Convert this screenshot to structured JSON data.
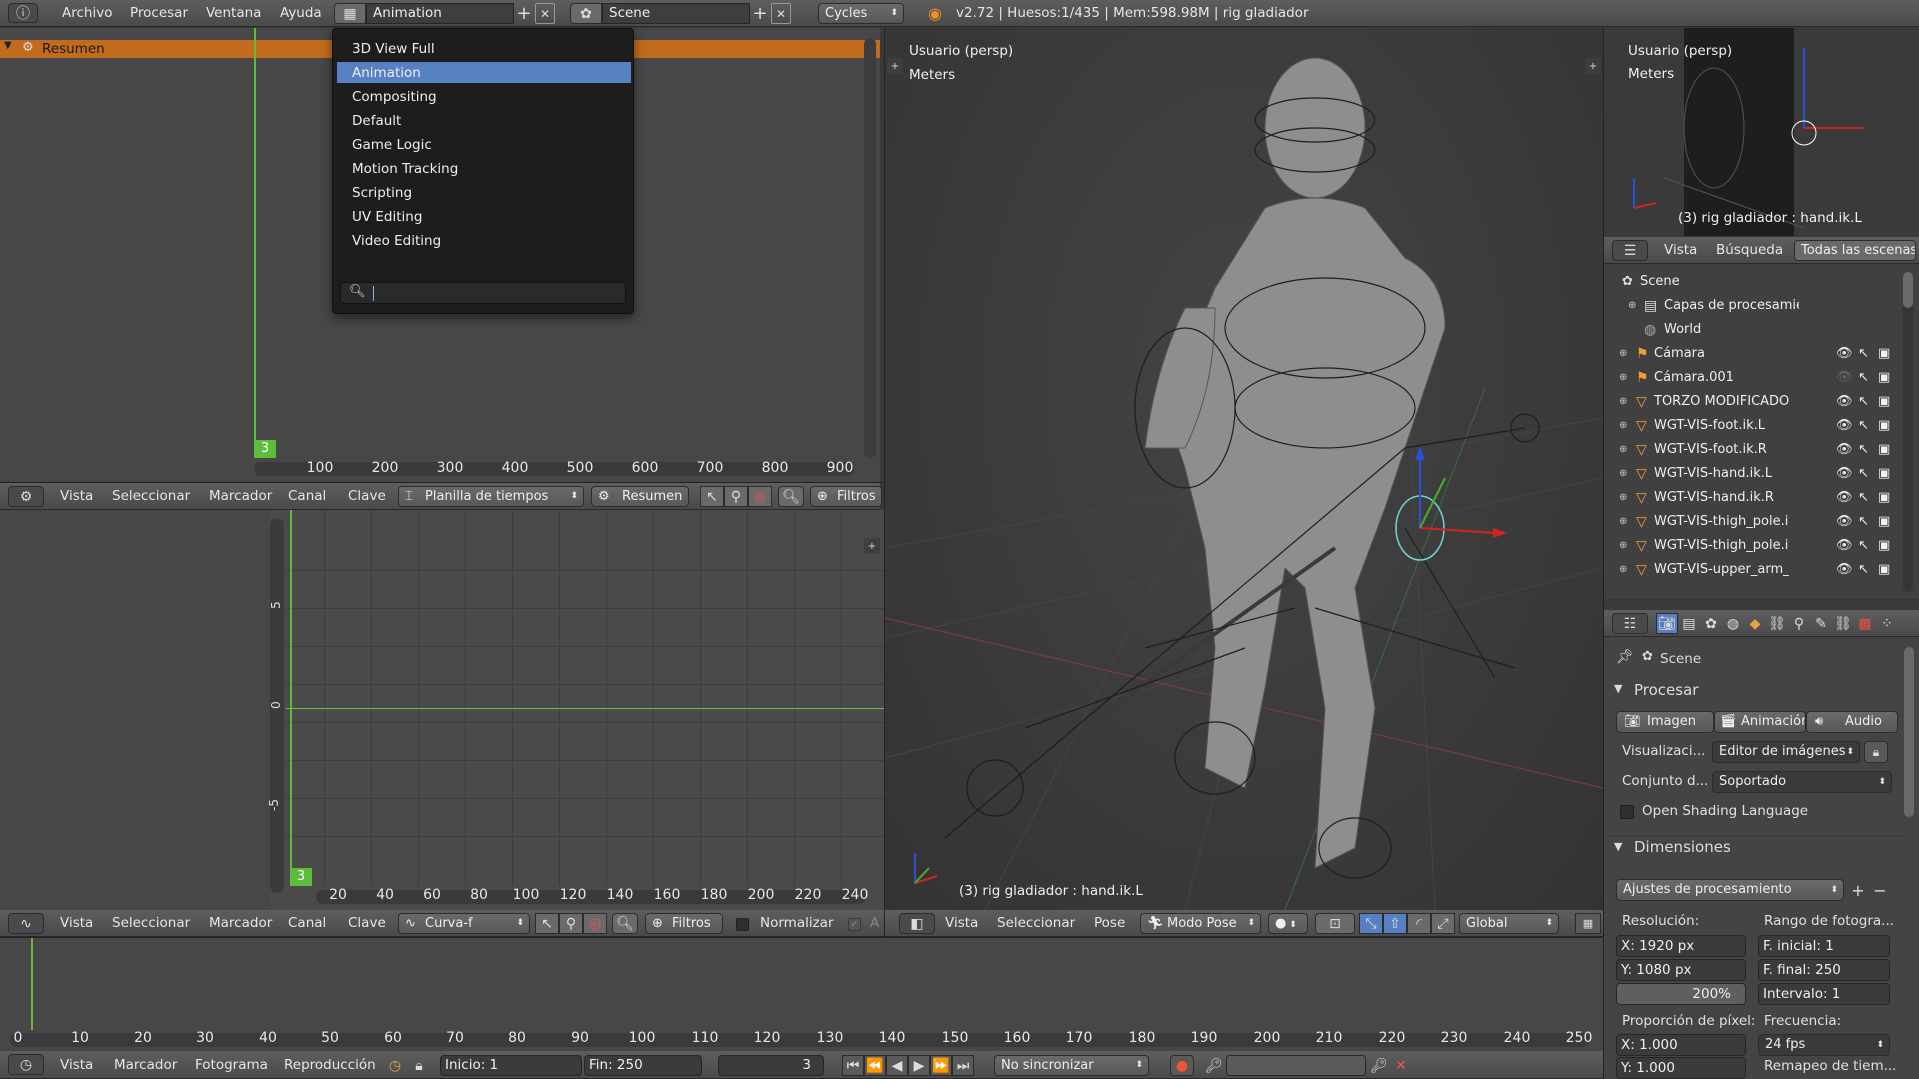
{
  "topbar": {
    "menus": [
      "Archivo",
      "Procesar",
      "Ventana",
      "Ayuda"
    ],
    "layout_name": "Animation",
    "scene_name": "Scene",
    "engine": "Cycles",
    "status": "v2.72 | Huesos:1/435  | Mem:598.98M | rig gladiador"
  },
  "layout_dropdown": {
    "items": [
      "3D View Full",
      "Animation",
      "Compositing",
      "Default",
      "Game Logic",
      "Motion Tracking",
      "Scripting",
      "UV Editing",
      "Video Editing"
    ],
    "selected": "Animation",
    "search_value": ""
  },
  "dopesheet": {
    "channel": "Resumen",
    "current_frame": "3",
    "ticks": [
      "100",
      "200",
      "300",
      "400",
      "500",
      "600",
      "700",
      "800",
      "900"
    ],
    "header": {
      "menus": [
        "Vista",
        "Seleccionar",
        "Marcador",
        "Canal",
        "Clave"
      ],
      "mode": "Planilla de tiempos",
      "summary": "Resumen",
      "filters": "Filtros"
    }
  },
  "graph": {
    "current_frame": "3",
    "xticks": [
      "20",
      "40",
      "60",
      "80",
      "100",
      "120",
      "140",
      "160",
      "180",
      "200",
      "220",
      "240"
    ],
    "yticks": [
      "5",
      "0",
      "-5"
    ],
    "header": {
      "menus": [
        "Vista",
        "Seleccionar",
        "Marcador",
        "Canal",
        "Clave"
      ],
      "mode": "Curva-f",
      "filters": "Filtros",
      "normalize": "Normalizar",
      "extra": "A"
    }
  },
  "viewport": {
    "view_label": "Usuario (persp)",
    "units": "Meters",
    "object_label": "(3) rig gladiador : hand.ik.L",
    "header": {
      "menus": [
        "Vista",
        "Seleccionar",
        "Pose"
      ],
      "mode": "Modo Pose",
      "orientation": "Global"
    }
  },
  "mini_viewport": {
    "view_label": "Usuario (persp)",
    "units": "Meters",
    "object_label": "(3) rig gladiador : hand.ik.L"
  },
  "outliner": {
    "tabs": [
      "Vista",
      "Búsqueda",
      "Todas las escenas"
    ],
    "rows": [
      {
        "name": "Scene",
        "kind": "scene"
      },
      {
        "name": "Capas de procesamiento",
        "kind": "layers"
      },
      {
        "name": "World",
        "kind": "world"
      },
      {
        "name": "Cámara",
        "kind": "camera"
      },
      {
        "name": "Cámara.001",
        "kind": "camera"
      },
      {
        "name": "TORZO MODIFICADO COR",
        "kind": "mesh"
      },
      {
        "name": "WGT-VIS-foot.ik.L",
        "kind": "mesh"
      },
      {
        "name": "WGT-VIS-foot.ik.R",
        "kind": "mesh"
      },
      {
        "name": "WGT-VIS-hand.ik.L",
        "kind": "mesh"
      },
      {
        "name": "WGT-VIS-hand.ik.R",
        "kind": "mesh"
      },
      {
        "name": "WGT-VIS-thigh_pole.ik.L",
        "kind": "mesh"
      },
      {
        "name": "WGT-VIS-thigh_pole.ik.R",
        "kind": "mesh"
      },
      {
        "name": "WGT-VIS-upper_arm_pole.i",
        "kind": "mesh"
      }
    ]
  },
  "properties": {
    "context": "Scene",
    "render_panel": {
      "title": "Procesar",
      "buttons": [
        "Imagen",
        "Animación",
        "Audio"
      ],
      "display_label": "Visualizaci...",
      "display_value": "Editor de imágenes",
      "feature_label": "Conjunto d...",
      "feature_value": "Soportado",
      "osl_label": "Open Shading Language"
    },
    "dimensions_panel": {
      "title": "Dimensiones",
      "preset": "Ajustes de procesamiento",
      "resolution_label": "Resolución:",
      "res_x": "X:     1920 px",
      "res_y": "Y:     1080 px",
      "res_pct": "200%",
      "frame_range_label": "Rango de fotogra...",
      "frame_start": "F. inicial:      1",
      "frame_end": "F. final:    250",
      "frame_step": "Intervalo:      1",
      "aspect_label": "Proporción de píxel:",
      "aspect_x": "X:      1.000",
      "aspect_y": "Y:      1.000",
      "fps_label": "Frecuencia:",
      "fps_value": "24 fps",
      "remap_label": "Remapeo de tiem..."
    }
  },
  "timeline": {
    "current_frame_marker": "3",
    "ticks": [
      "0",
      "10",
      "20",
      "30",
      "40",
      "50",
      "60",
      "70",
      "80",
      "90",
      "100",
      "110",
      "120",
      "130",
      "140",
      "150",
      "160",
      "170",
      "180",
      "190",
      "200",
      "210",
      "220",
      "230",
      "240",
      "250"
    ],
    "header": {
      "menus": [
        "Vista",
        "Marcador",
        "Fotograma",
        "Reproducción"
      ],
      "start": "Inicio:         1",
      "end": "Fin:       250",
      "current": "3",
      "sync": "No sincronizar"
    }
  },
  "colors": {
    "accent_orange": "#e87d0d",
    "selected_blue": "#5680c2",
    "frame_green": "#5bbd3a"
  }
}
